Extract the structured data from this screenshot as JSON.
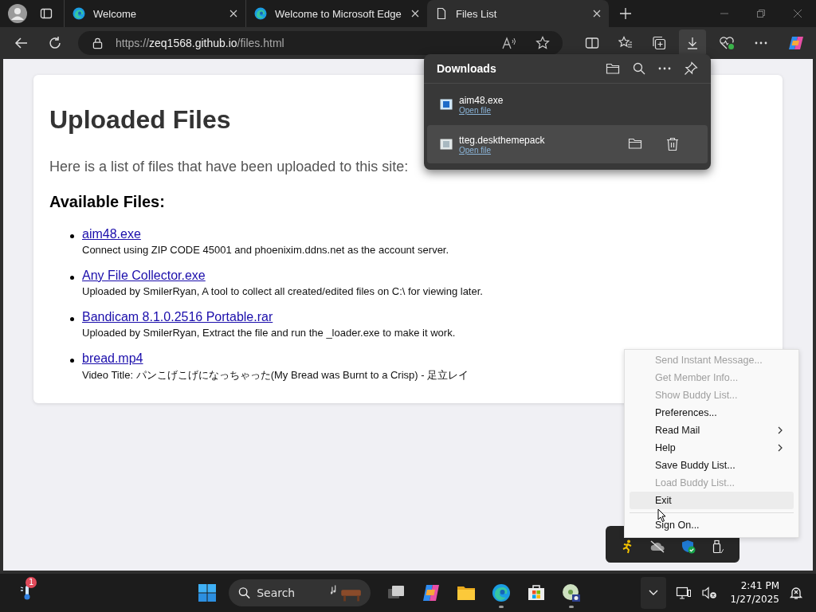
{
  "browser": {
    "tabs": [
      {
        "title": "Welcome",
        "selected": false
      },
      {
        "title": "Welcome to Microsoft Edge",
        "selected": false
      },
      {
        "title": "Files List",
        "selected": true
      }
    ],
    "address": {
      "scheme": "https://",
      "host": "zeq1568.github.io",
      "path": "/files.html"
    }
  },
  "downloads": {
    "title": "Downloads",
    "items": [
      {
        "name": "aim48.exe",
        "action": "Open file",
        "selected": false
      },
      {
        "name": "tteg.deskthemepack",
        "action": "Open file",
        "selected": true
      }
    ]
  },
  "page": {
    "title": "Uploaded Files",
    "intro": "Here is a list of files that have been uploaded to this site:",
    "subtitle": "Available Files:",
    "files": [
      {
        "name": "aim48.exe",
        "description": "Connect using ZIP CODE 45001 and phoenixim.ddns.net as the account server."
      },
      {
        "name": "Any File Collector.exe",
        "description": "Uploaded by SmilerRyan, A tool to collect all created/edited files on C:\\ for viewing later."
      },
      {
        "name": "Bandicam 8.1.0.2516 Portable.rar",
        "description": "Uploaded by SmilerRyan, Extract the file and run the _loader.exe to make it work."
      },
      {
        "name": "bread.mp4",
        "description": "Video Title: パンこげこげになっちゃった(My Bread was Burnt to a Crisp) - 足立レイ"
      }
    ]
  },
  "context_menu": {
    "items": [
      {
        "kind": "item",
        "label": "Send Instant Message...",
        "disabled": true,
        "submenu": false,
        "selected": false
      },
      {
        "kind": "item",
        "label": "Get Member Info...",
        "disabled": true,
        "submenu": false,
        "selected": false
      },
      {
        "kind": "item",
        "label": "Show Buddy List...",
        "disabled": true,
        "submenu": false,
        "selected": false
      },
      {
        "kind": "item",
        "label": "Preferences...",
        "disabled": false,
        "submenu": false,
        "selected": false
      },
      {
        "kind": "item",
        "label": "Read Mail",
        "disabled": false,
        "submenu": true,
        "selected": false
      },
      {
        "kind": "item",
        "label": "Help",
        "disabled": false,
        "submenu": true,
        "selected": false
      },
      {
        "kind": "item",
        "label": "Save Buddy List...",
        "disabled": false,
        "submenu": false,
        "selected": false
      },
      {
        "kind": "item",
        "label": "Load Buddy List...",
        "disabled": true,
        "submenu": false,
        "selected": false
      },
      {
        "kind": "item",
        "label": "Exit",
        "disabled": false,
        "submenu": false,
        "selected": true
      },
      {
        "kind": "separator"
      },
      {
        "kind": "item",
        "label": "Sign On...",
        "disabled": false,
        "submenu": false,
        "selected": false
      }
    ]
  },
  "taskbar": {
    "weather_badge": "1",
    "search": {
      "label": "Search"
    },
    "apps": [
      {
        "kind": "taskview",
        "running": false
      },
      {
        "kind": "copilot",
        "running": false
      },
      {
        "kind": "explorer",
        "running": false
      },
      {
        "kind": "edge",
        "running": true
      },
      {
        "kind": "store",
        "running": false
      },
      {
        "kind": "disc",
        "running": true
      }
    ],
    "time": "2:41 PM",
    "date": "1/27/2025"
  }
}
